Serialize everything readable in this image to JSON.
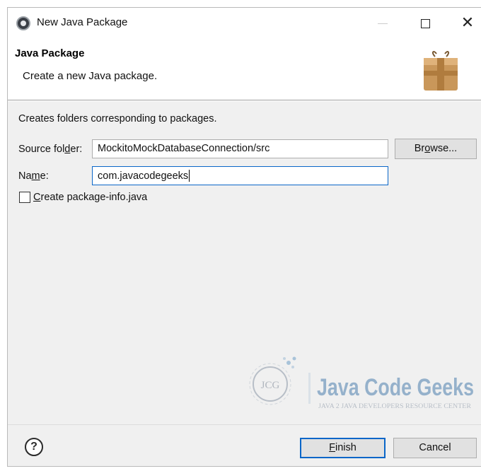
{
  "window": {
    "title": "New Java Package",
    "minimize_glyph": "—",
    "close_glyph": "✕"
  },
  "banner": {
    "title": "Java Package",
    "description": "Create a new Java package."
  },
  "form": {
    "intro": "Creates folders corresponding to packages.",
    "source_folder": {
      "label_pre": "Source fol",
      "label_mnemonic": "d",
      "label_post": "er:",
      "value": "MockitoMockDatabaseConnection/src"
    },
    "browse": {
      "label_pre": "Br",
      "label_mnemonic": "o",
      "label_post": "wse..."
    },
    "name": {
      "label_pre": "Na",
      "label_mnemonic": "m",
      "label_post": "e:",
      "value": "com.javacodegeeks"
    },
    "create_package_info": {
      "label_mnemonic": "C",
      "label_post": "reate package-info.java",
      "checked": false
    }
  },
  "footer": {
    "help_glyph": "?",
    "finish": {
      "label_mnemonic": "F",
      "label_post": "inish"
    },
    "cancel": {
      "label": "Cancel"
    }
  },
  "watermark": {
    "logo_text": "JCG",
    "brand": "Java Code Geeks",
    "tagline": "JAVA 2 JAVA DEVELOPERS RESOURCE CENTER"
  },
  "colors": {
    "focus_border": "#0a66c8",
    "dialog_bg": "#f0f0f0",
    "button_bg": "#e1e1e1"
  }
}
